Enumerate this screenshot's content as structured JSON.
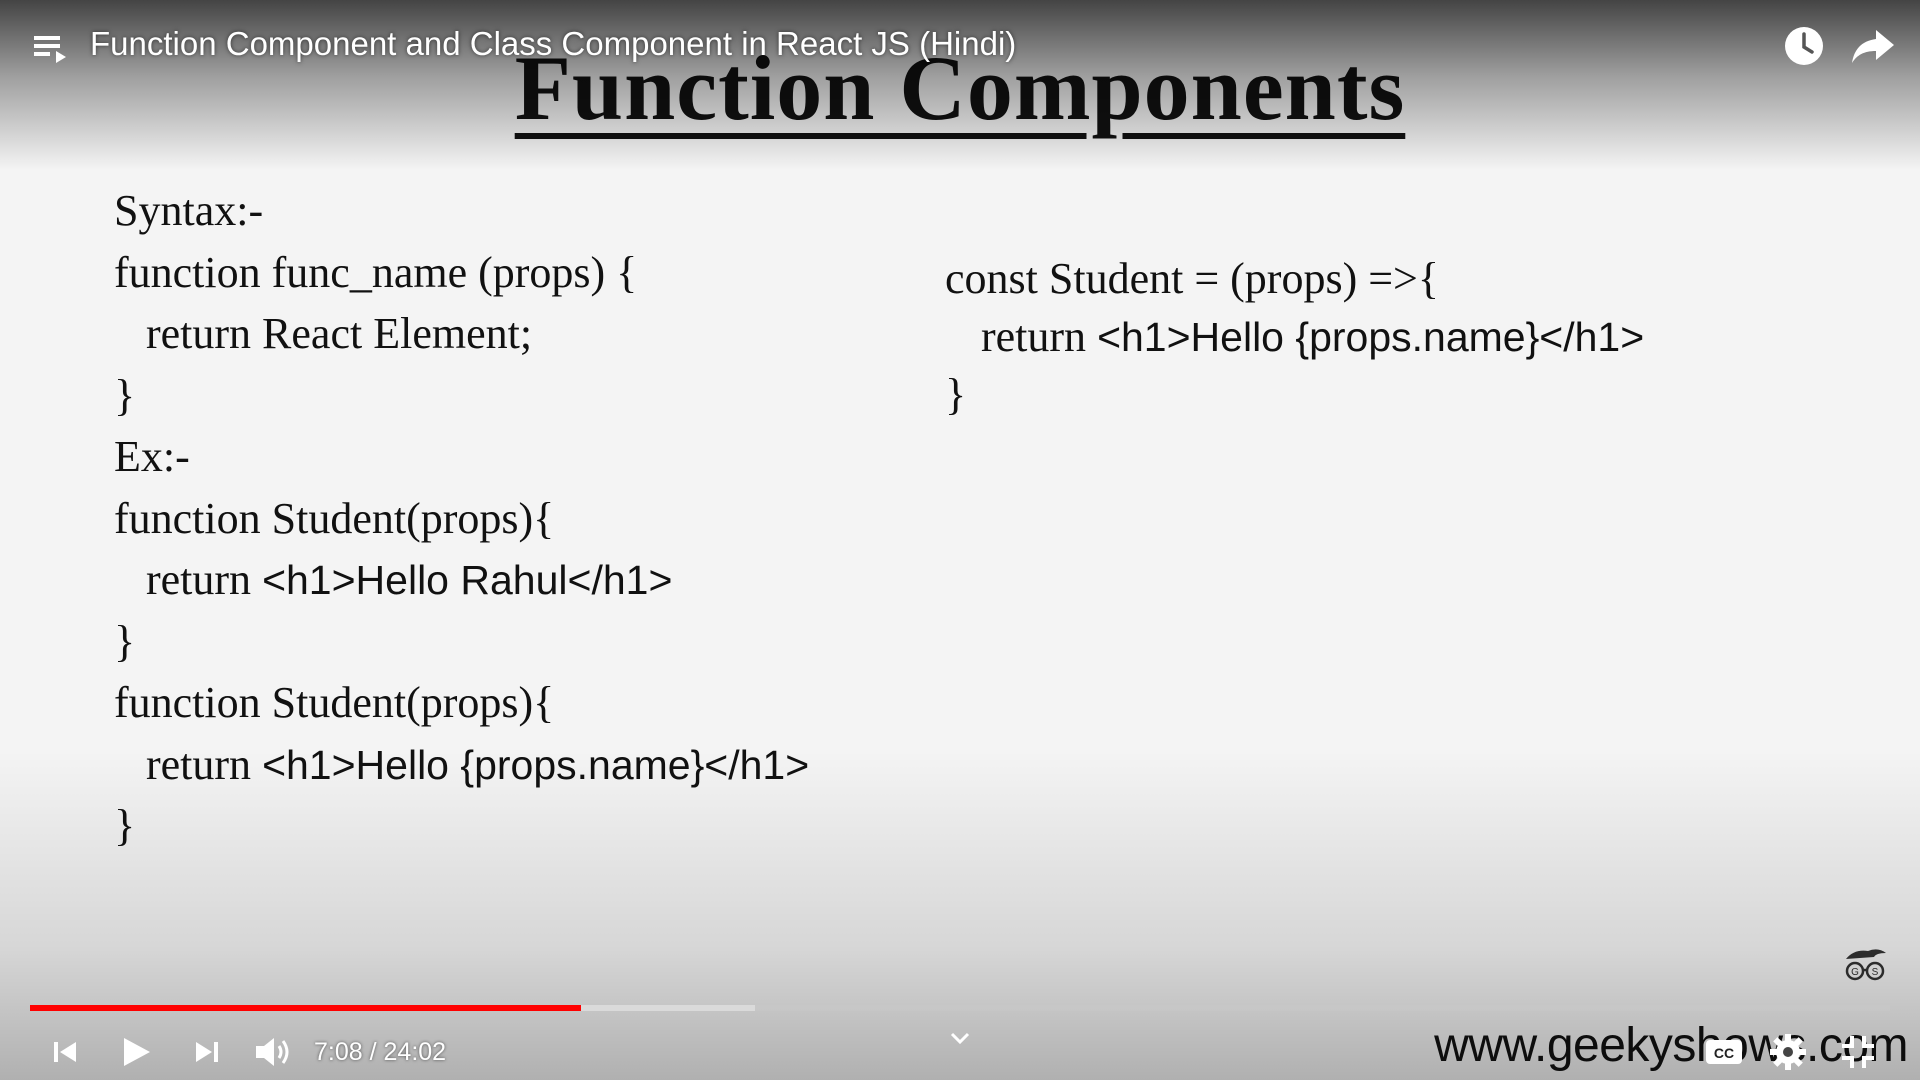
{
  "player": {
    "video_title": "Function Component and Class Component in React JS (Hindi)",
    "time_current": "7:08",
    "time_separator": " / ",
    "time_total": "24:02",
    "progress_played_fraction": 0.296,
    "progress_buffered_fraction": 0.39,
    "colors": {
      "progress_played": "#ff0000",
      "controls": "#ffffff"
    },
    "icons": {
      "playlist": "playlist-icon",
      "watch_later": "clock-icon",
      "share": "share-arrow-icon",
      "previous": "skip-previous-icon",
      "play": "play-icon",
      "next": "skip-next-icon",
      "volume": "volume-icon",
      "chevron": "chevron-down-icon",
      "captions": "cc-icon",
      "settings": "gear-icon",
      "fullscreen": "exit-fullscreen-icon"
    }
  },
  "slide": {
    "title": "Function Components",
    "left_lines": [
      {
        "text": "Syntax:-",
        "indent": false,
        "sans": false
      },
      {
        "text": "function func_name (props) {",
        "indent": false,
        "sans": false
      },
      {
        "text": "return React Element;",
        "indent": true,
        "sans": false
      },
      {
        "text": "}",
        "indent": false,
        "sans": false
      },
      {
        "text": "Ex:-",
        "indent": false,
        "sans": false
      },
      {
        "text": "function Student(props){",
        "indent": false,
        "sans": false
      },
      {
        "text_prefix": "return ",
        "text": "<h1>Hello Rahul</h1>",
        "indent": true,
        "sans": true
      },
      {
        "text": "}",
        "indent": false,
        "sans": false
      },
      {
        "text": "function Student(props){",
        "indent": false,
        "sans": false
      },
      {
        "text_prefix": "return ",
        "text": "<h1>Hello {props.name}</h1>",
        "indent": true,
        "sans": true
      },
      {
        "text": "}",
        "indent": false,
        "sans": false
      }
    ],
    "right_lines": [
      {
        "text": "const Student = (props) =>{",
        "indent": false,
        "sans": false
      },
      {
        "text_prefix": "return ",
        "text": "<h1>Hello {props.name}</h1>",
        "indent": true,
        "sans": true
      },
      {
        "text": "}",
        "indent": false,
        "sans": false
      }
    ],
    "website": "www.geekyshows.com"
  }
}
